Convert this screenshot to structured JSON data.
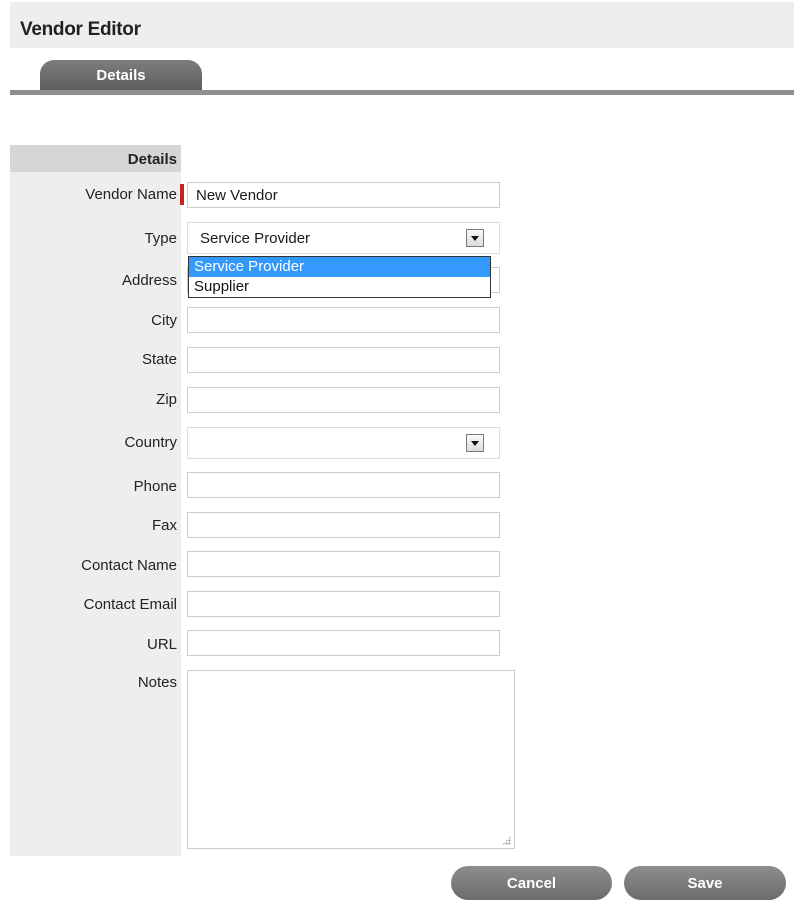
{
  "header": {
    "title": "Vendor Editor"
  },
  "tabs": [
    {
      "label": "Details"
    }
  ],
  "section": {
    "title": "Details"
  },
  "fields": {
    "vendor_name": {
      "label": "Vendor Name",
      "value": "New Vendor",
      "required": true
    },
    "type": {
      "label": "Type",
      "value": "Service Provider",
      "options": [
        "Service Provider",
        "Supplier"
      ]
    },
    "address": {
      "label": "Address",
      "value": ""
    },
    "city": {
      "label": "City",
      "value": ""
    },
    "state": {
      "label": "State",
      "value": ""
    },
    "zip": {
      "label": "Zip",
      "value": ""
    },
    "country": {
      "label": "Country",
      "value": ""
    },
    "phone": {
      "label": "Phone",
      "value": ""
    },
    "fax": {
      "label": "Fax",
      "value": ""
    },
    "contact_name": {
      "label": "Contact Name",
      "value": ""
    },
    "contact_email": {
      "label": "Contact Email",
      "value": ""
    },
    "url": {
      "label": "URL",
      "value": ""
    },
    "notes": {
      "label": "Notes",
      "value": ""
    }
  },
  "buttons": {
    "cancel": "Cancel",
    "save": "Save"
  },
  "colors": {
    "required_marker": "#cc1f1f",
    "dropdown_highlight": "#3399ff",
    "button_gray": "#7a7a7a"
  },
  "icons": {
    "select_arrow": "chevron-down-icon",
    "resize_grip": "resize-grip-icon"
  }
}
